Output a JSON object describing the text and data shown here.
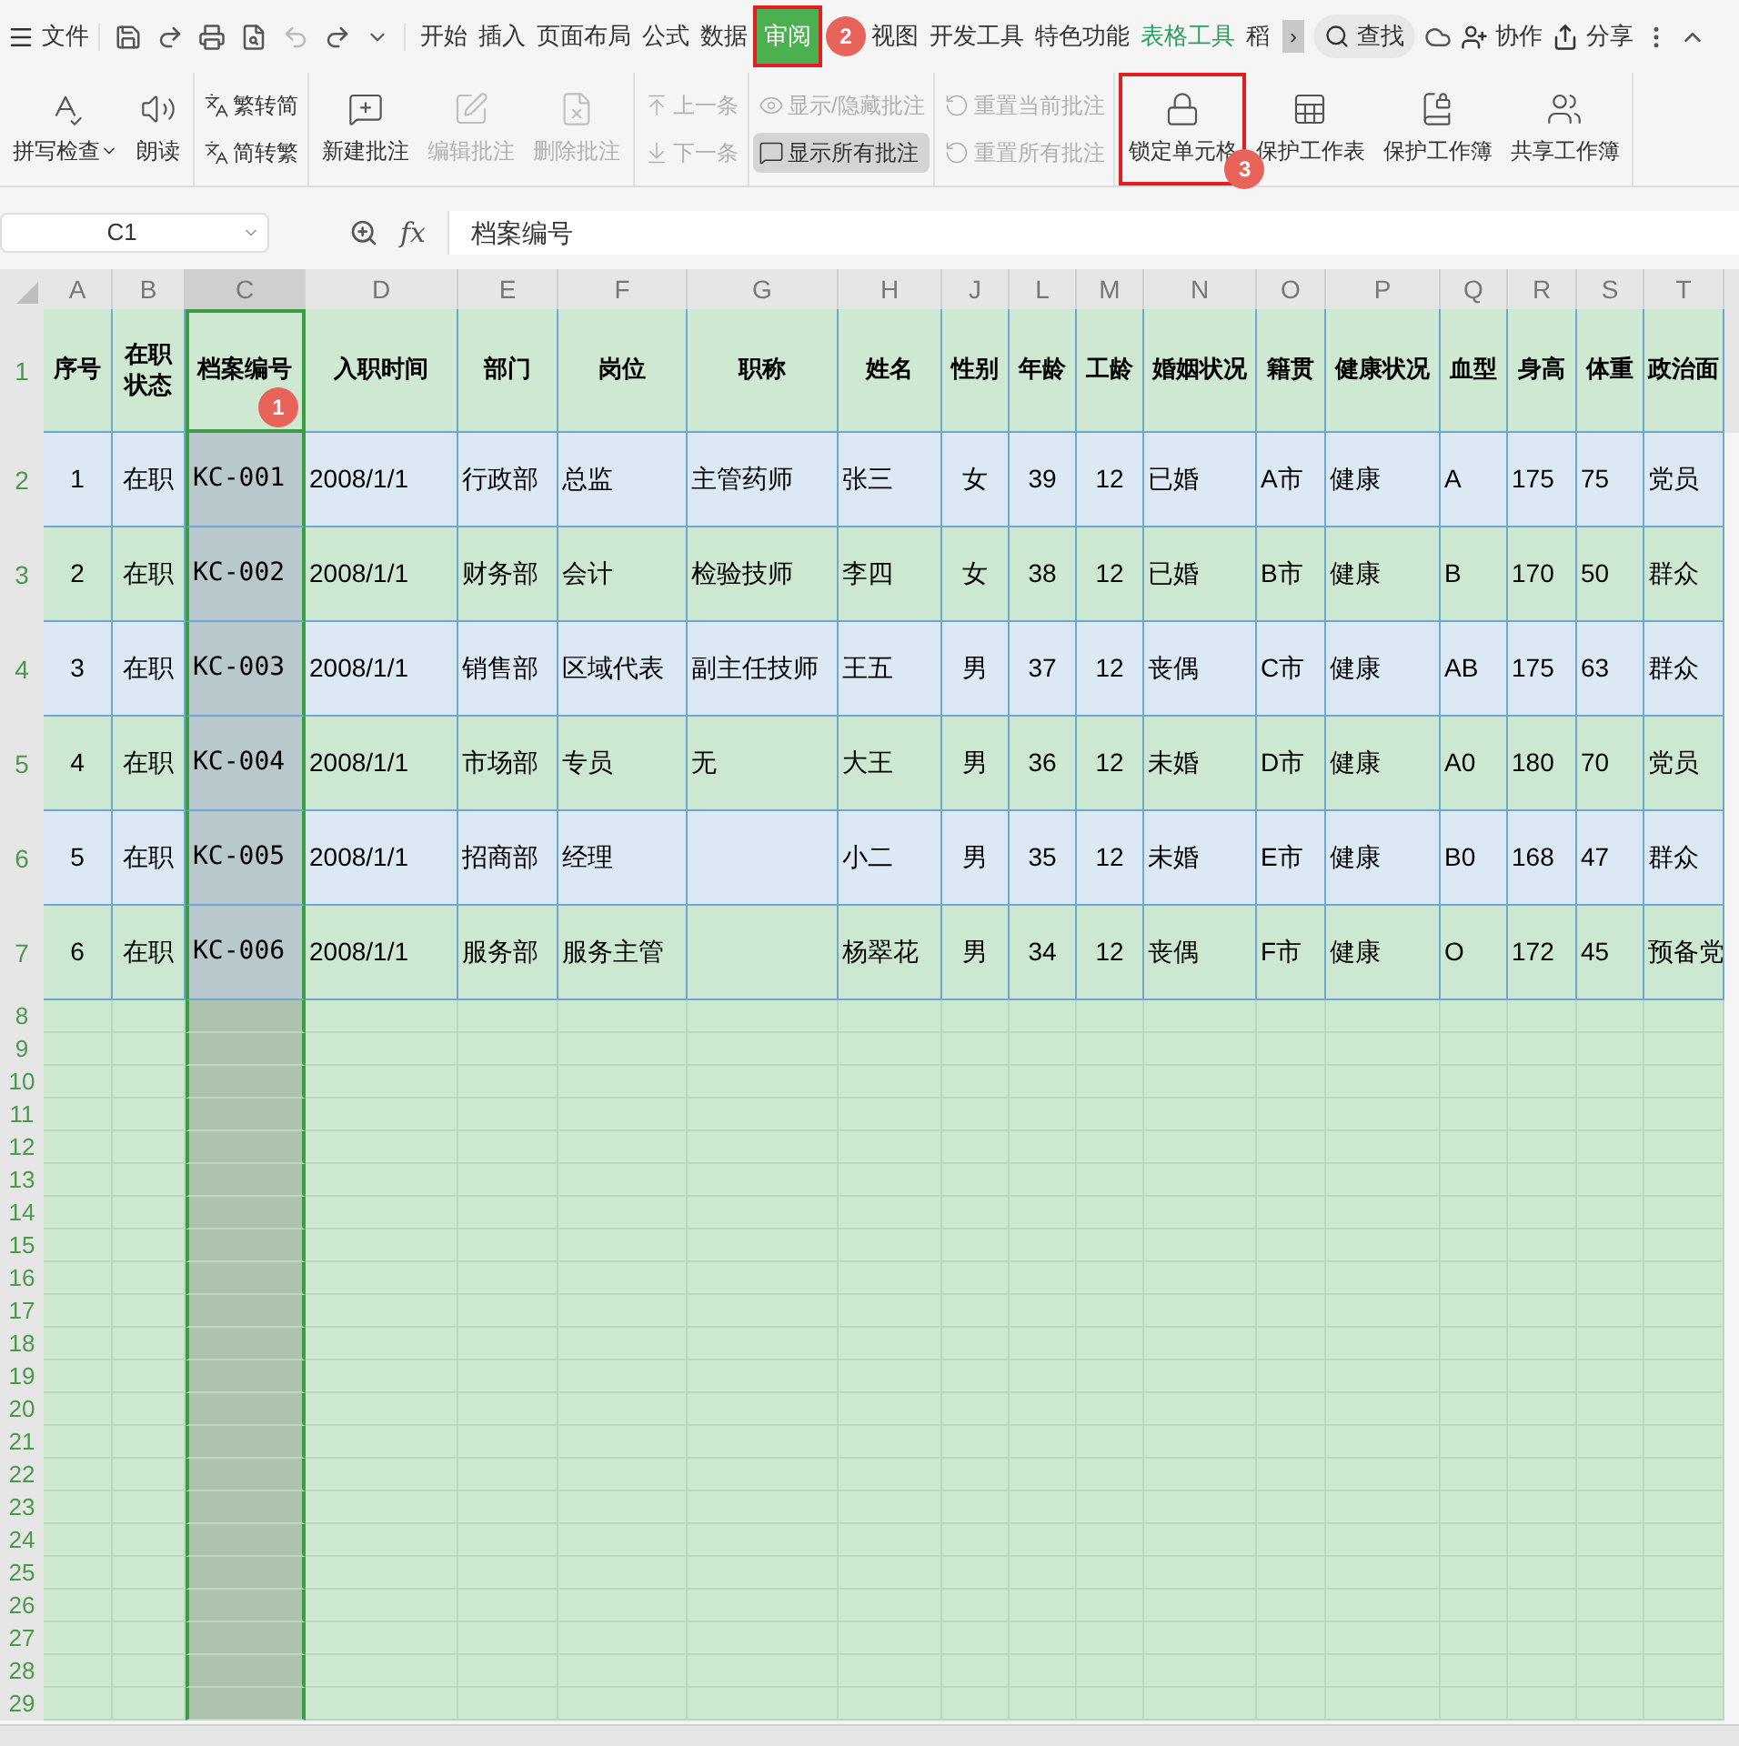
{
  "menu": {
    "file": "文件",
    "tabs": [
      {
        "label": "开始",
        "selected": false,
        "kind": "normal"
      },
      {
        "label": "插入",
        "selected": false,
        "kind": "normal"
      },
      {
        "label": "页面布局",
        "selected": false,
        "kind": "normal"
      },
      {
        "label": "公式",
        "selected": false,
        "kind": "normal"
      },
      {
        "label": "数据",
        "selected": false,
        "kind": "normal"
      },
      {
        "label": "审阅",
        "selected": true,
        "kind": "normal",
        "highlighted": true,
        "badge": "2"
      },
      {
        "label": "视图",
        "selected": false,
        "kind": "normal"
      },
      {
        "label": "开发工具",
        "selected": false,
        "kind": "normal"
      },
      {
        "label": "特色功能",
        "selected": false,
        "kind": "normal"
      },
      {
        "label": "表格工具",
        "selected": false,
        "kind": "context"
      },
      {
        "label": "稻",
        "selected": false,
        "kind": "normal"
      }
    ],
    "more": "›",
    "search": "查找",
    "collab": "协作",
    "share": "分享"
  },
  "ribbon": [
    {
      "kind": "large",
      "items": [
        {
          "label": "拼写检查",
          "disabled": false,
          "has_menu": true
        },
        {
          "label": "朗读",
          "disabled": false
        }
      ]
    },
    {
      "kind": "stack",
      "items": [
        {
          "label": "繁转简",
          "disabled": false
        },
        {
          "label": "简转繁",
          "disabled": false
        }
      ]
    },
    {
      "kind": "large",
      "items": [
        {
          "label": "新建批注",
          "disabled": false
        },
        {
          "label": "编辑批注",
          "disabled": true
        },
        {
          "label": "删除批注",
          "disabled": true
        }
      ]
    },
    {
      "kind": "stack",
      "items": [
        {
          "label": "上一条",
          "disabled": true
        },
        {
          "label": "下一条",
          "disabled": true
        }
      ]
    },
    {
      "kind": "stack",
      "items": [
        {
          "label": "显示/隐藏批注",
          "disabled": true
        },
        {
          "label": "显示所有批注",
          "disabled": false,
          "pressed": true
        }
      ]
    },
    {
      "kind": "stack",
      "items": [
        {
          "label": "重置当前批注",
          "disabled": true
        },
        {
          "label": "重置所有批注",
          "disabled": true
        }
      ]
    },
    {
      "kind": "large",
      "items": [
        {
          "label": "锁定单元格",
          "disabled": false,
          "highlighted": true,
          "badge": "3"
        },
        {
          "label": "保护工作表",
          "disabled": false
        },
        {
          "label": "保护工作簿",
          "disabled": false
        },
        {
          "label": "共享工作簿",
          "disabled": false
        }
      ]
    }
  ],
  "name_box": "C1",
  "function_label": "fx",
  "formula": "档案编号",
  "columns": [
    {
      "label": "A",
      "selected": false
    },
    {
      "label": "B",
      "selected": false
    },
    {
      "label": "C",
      "selected": true
    },
    {
      "label": "D",
      "selected": false
    },
    {
      "label": "E",
      "selected": false
    },
    {
      "label": "F",
      "selected": false
    },
    {
      "label": "G",
      "selected": false
    },
    {
      "label": "H",
      "selected": false
    },
    {
      "label": "J",
      "selected": false
    },
    {
      "label": "L",
      "selected": false
    },
    {
      "label": "M",
      "selected": false
    },
    {
      "label": "N",
      "selected": false
    },
    {
      "label": "O",
      "selected": false
    },
    {
      "label": "P",
      "selected": false
    },
    {
      "label": "Q",
      "selected": false
    },
    {
      "label": "R",
      "selected": false
    },
    {
      "label": "S",
      "selected": false
    },
    {
      "label": "T",
      "selected": false
    }
  ],
  "header_row": {
    "number": "1",
    "cells": [
      "序号",
      "在职状态",
      "档案编号",
      "入职时间",
      "部门",
      "岗位",
      "职称",
      "姓名",
      "性别",
      "年龄",
      "工龄",
      "婚姻状况",
      "籍贯",
      "健康状况",
      "血型",
      "身高",
      "体重",
      "政治面"
    ],
    "badge": "1"
  },
  "rows": [
    {
      "number": "2",
      "cells": [
        "1",
        "在职",
        "KC-001",
        "2008/1/1",
        "行政部",
        "总监",
        "主管药师",
        "张三",
        "女",
        "39",
        "12",
        "已婚",
        "A市",
        "健康",
        "A",
        "175",
        "75",
        "党员"
      ]
    },
    {
      "number": "3",
      "cells": [
        "2",
        "在职",
        "KC-002",
        "2008/1/1",
        "财务部",
        "会计",
        "检验技师",
        "李四",
        "女",
        "38",
        "12",
        "已婚",
        "B市",
        "健康",
        "B",
        "170",
        "50",
        "群众"
      ]
    },
    {
      "number": "4",
      "cells": [
        "3",
        "在职",
        "KC-003",
        "2008/1/1",
        "销售部",
        "区域代表",
        "副主任技师",
        "王五",
        "男",
        "37",
        "12",
        "丧偶",
        "C市",
        "健康",
        "AB",
        "175",
        "63",
        "群众"
      ]
    },
    {
      "number": "5",
      "cells": [
        "4",
        "在职",
        "KC-004",
        "2008/1/1",
        "市场部",
        "专员",
        "无",
        "大王",
        "男",
        "36",
        "12",
        "未婚",
        "D市",
        "健康",
        "A0",
        "180",
        "70",
        "党员"
      ]
    },
    {
      "number": "6",
      "cells": [
        "5",
        "在职",
        "KC-005",
        "2008/1/1",
        "招商部",
        "经理",
        "",
        "小二",
        "男",
        "35",
        "12",
        "未婚",
        "E市",
        "健康",
        "B0",
        "168",
        "47",
        "群众"
      ]
    },
    {
      "number": "7",
      "cells": [
        "6",
        "在职",
        "KC-006",
        "2008/1/1",
        "服务部",
        "服务主管",
        "",
        "杨翠花",
        "男",
        "34",
        "12",
        "丧偶",
        "F市",
        "健康",
        "O",
        "172",
        "45",
        "预备党"
      ]
    }
  ],
  "empty_rows": [
    "8",
    "9",
    "10",
    "11",
    "12",
    "13",
    "14",
    "15",
    "16",
    "17",
    "18",
    "19",
    "20",
    "21",
    "22",
    "23",
    "24",
    "25",
    "26",
    "27",
    "28",
    "29"
  ]
}
